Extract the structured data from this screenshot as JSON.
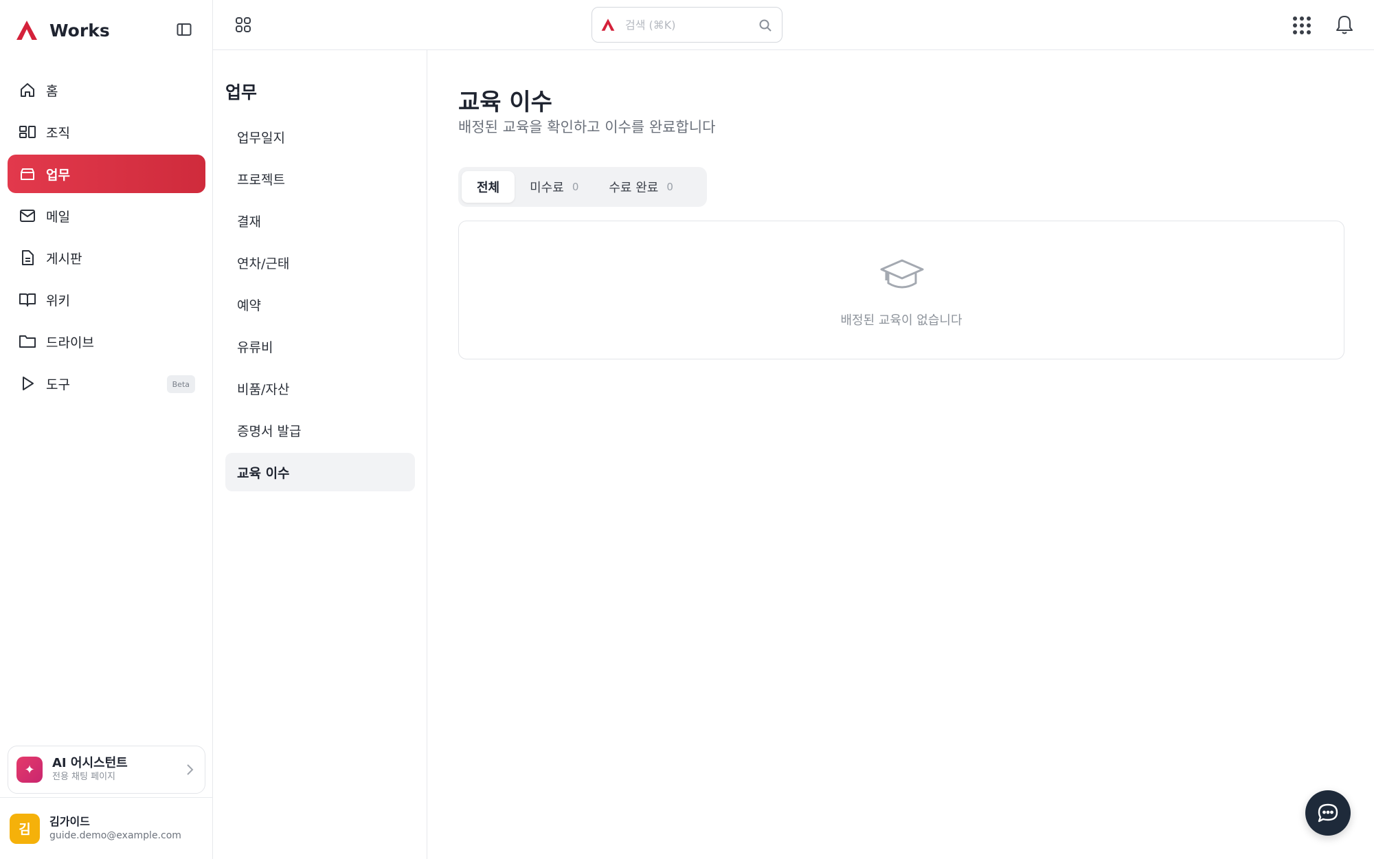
{
  "app": {
    "name": "Works",
    "brand_color": "#d4213a"
  },
  "sidebar": {
    "items": [
      {
        "label": "홈",
        "icon": "home-icon"
      },
      {
        "label": "조직",
        "icon": "org-icon"
      },
      {
        "label": "업무",
        "icon": "briefcase-icon",
        "active": true
      },
      {
        "label": "메일",
        "icon": "mail-icon"
      },
      {
        "label": "게시판",
        "icon": "document-icon"
      },
      {
        "label": "위키",
        "icon": "book-icon"
      },
      {
        "label": "드라이브",
        "icon": "folder-icon"
      },
      {
        "label": "도구",
        "icon": "play-icon",
        "badge": "Beta"
      }
    ],
    "ai_card": {
      "title": "AI 어시스턴트",
      "subtitle": "전용 채팅 페이지"
    },
    "user": {
      "initial": "김",
      "name": "김가이드",
      "email": "guide.demo@example.com"
    }
  },
  "topbar": {
    "search_placeholder": "검색 (⌘K)"
  },
  "submenu": {
    "title": "업무",
    "items": [
      {
        "label": "업무일지"
      },
      {
        "label": "프로젝트"
      },
      {
        "label": "결재"
      },
      {
        "label": "연차/근태"
      },
      {
        "label": "예약"
      },
      {
        "label": "유류비"
      },
      {
        "label": "비품/자산"
      },
      {
        "label": "증명서 발급"
      },
      {
        "label": "교육 이수",
        "active": true
      }
    ]
  },
  "main": {
    "title": "교육 이수",
    "subtitle": "배정된 교육을 확인하고 이수를 완료합니다",
    "tabs": [
      {
        "label": "전체",
        "active": true
      },
      {
        "label": "미수료",
        "count": "0"
      },
      {
        "label": "수료 완료",
        "count": "0"
      }
    ],
    "empty_text": "배정된 교육이 없습니다"
  },
  "colors": {
    "active_nav": "#dc3446",
    "avatar": "#f5b10a",
    "chat_fab": "#1e2a3a"
  }
}
